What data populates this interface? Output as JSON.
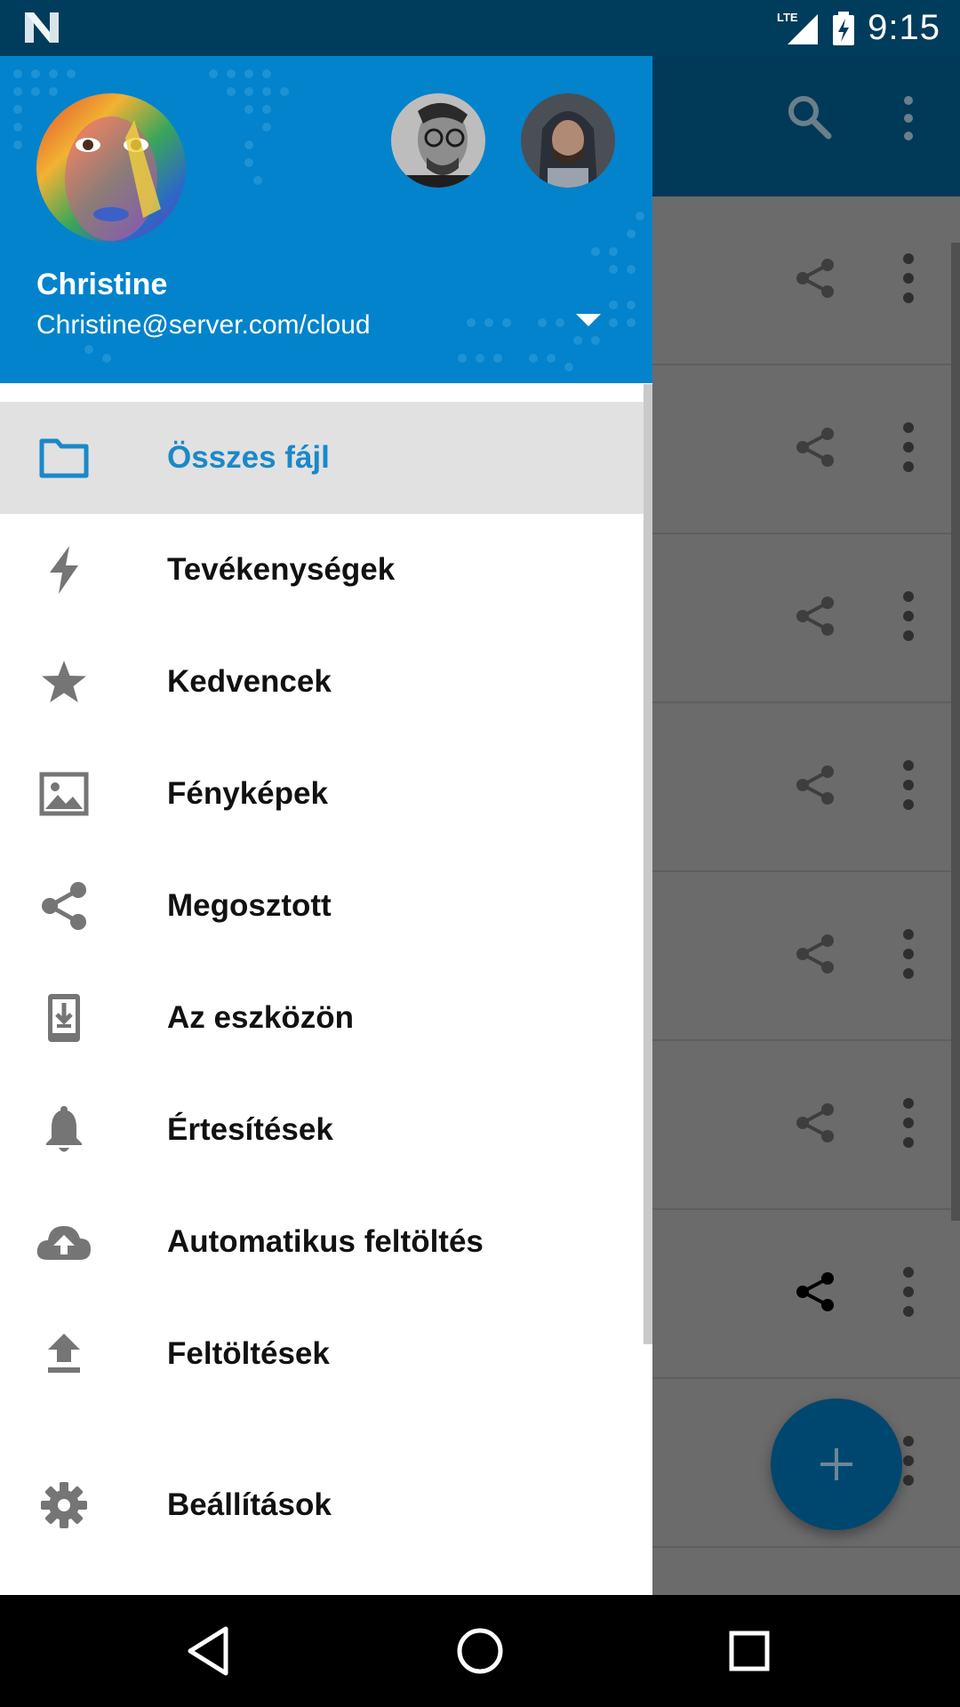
{
  "status_bar": {
    "network": "LTE",
    "time": "9:15",
    "icons": [
      "notification-n-icon",
      "lte-signal-icon",
      "battery-charging-icon"
    ]
  },
  "drawer": {
    "user": {
      "name": "Christine",
      "account": "Christine@server.com/cloud"
    },
    "menu": [
      {
        "label": "Összes fájl",
        "icon": "folder-icon",
        "active": true
      },
      {
        "label": "Tevékenységek",
        "icon": "lightning-icon",
        "active": false
      },
      {
        "label": "Kedvencek",
        "icon": "star-icon",
        "active": false
      },
      {
        "label": "Fényképek",
        "icon": "image-icon",
        "active": false
      },
      {
        "label": "Megosztott",
        "icon": "share-icon",
        "active": false
      },
      {
        "label": "Az eszközön",
        "icon": "device-download-icon",
        "active": false
      },
      {
        "label": "Értesítések",
        "icon": "bell-icon",
        "active": false
      },
      {
        "label": "Automatikus feltöltés",
        "icon": "cloud-upload-icon",
        "active": false
      },
      {
        "label": "Feltöltések",
        "icon": "upload-icon",
        "active": false
      }
    ],
    "settings": {
      "label": "Beállítások",
      "icon": "gear-icon"
    }
  },
  "background_app": {
    "toolbar_icons": [
      "search-icon",
      "more-vert-icon"
    ],
    "row_count": 8,
    "fab_icon": "plus-icon"
  },
  "colors": {
    "status_bar": "#003c5c",
    "header": "#0283cc",
    "active_text": "#1a88c9",
    "active_bg": "#e1e1e1",
    "fab": "#00476f"
  }
}
